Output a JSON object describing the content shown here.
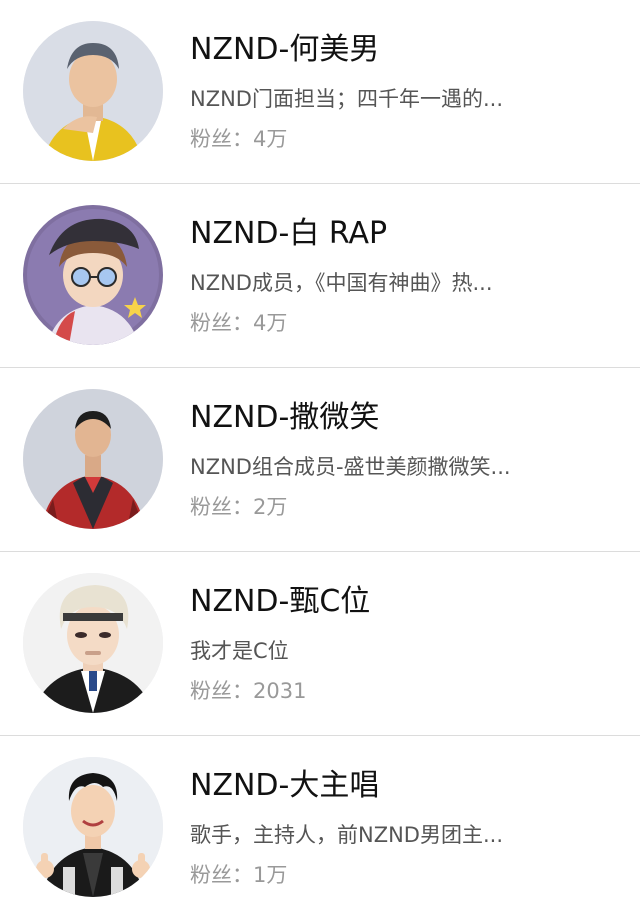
{
  "users": [
    {
      "name": "NZND-何美男",
      "description": "NZND门面担当；四千年一遇的...",
      "fans_label": "粉丝：",
      "fans_count": "4万",
      "avatar_icon": "avatar-man-yellow-jacket",
      "avatar_bg": "#d9dde6",
      "accent": "#e8c21f"
    },
    {
      "name": "NZND-白 RAP",
      "description": "NZND成员，《中国有神曲》热...",
      "fans_label": "粉丝：",
      "fans_count": "4万",
      "avatar_icon": "avatar-cartoon-boy-hat",
      "avatar_bg": "#7f6fa0",
      "accent": "#f0d4b8"
    },
    {
      "name": "NZND-撒微笑",
      "description": "NZND组合成员-盛世美颜撒微笑...",
      "fans_label": "粉丝：",
      "fans_count": "2万",
      "avatar_icon": "avatar-man-red-plaid-coat",
      "avatar_bg": "#cfd3dc",
      "accent": "#b32a2a"
    },
    {
      "name": "NZND-甄C位",
      "description": "我才是C位",
      "fans_label": "粉丝：",
      "fans_count": "2031",
      "avatar_icon": "avatar-man-blond-hair",
      "avatar_bg": "#f2f2f2",
      "accent": "#1c1c1c"
    },
    {
      "name": "NZND-大主唱",
      "description": "歌手，主持人，前NZND男团主...",
      "fans_label": "粉丝：",
      "fans_count": "1万",
      "avatar_icon": "avatar-man-thumbs-up",
      "avatar_bg": "#eceff3",
      "accent": "#1a1a1a"
    }
  ]
}
